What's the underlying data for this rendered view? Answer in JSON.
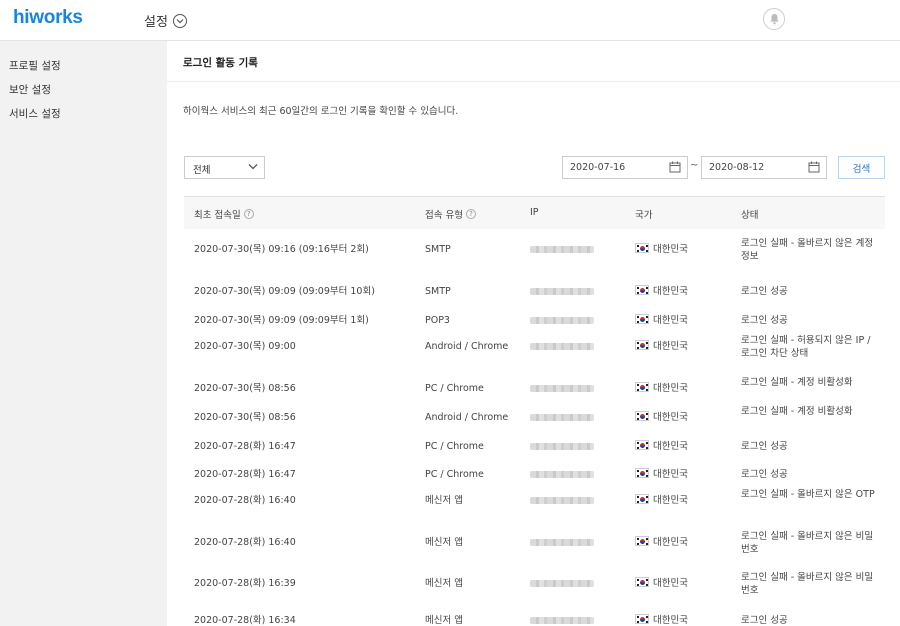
{
  "app": {
    "logo": "hiworks",
    "menu_title": "설정"
  },
  "colors": {
    "brand": "#1a85e0",
    "sidebar_bg": "#f2f2f2",
    "search_text": "#2d74c4"
  },
  "sidebar": {
    "items": [
      {
        "label": "프로필 설정"
      },
      {
        "label": "보안 설정"
      },
      {
        "label": "서비스 설정"
      }
    ]
  },
  "main": {
    "title": "로그인 활동 기록",
    "description": "하이웍스 서비스의 최근 60일간의 로그인 기록을 확인할 수 있습니다.",
    "filter": {
      "select_value": "전체",
      "date_from": "2020-07-16",
      "date_to": "2020-08-12",
      "separator": "~",
      "search_label": "검색"
    },
    "table": {
      "headers": [
        "최초 접속일",
        "접속 유형",
        "IP",
        "국가",
        "상태"
      ],
      "rows": [
        {
          "date": "2020-07-30(목) 09:16 (09:16부터 2회)",
          "type": "SMTP",
          "country": "대한민국",
          "status": "로그인 실패 - 올바르지 않은 계정 정보"
        },
        {
          "date": "2020-07-30(목) 09:09 (09:09부터 10회)",
          "type": "SMTP",
          "country": "대한민국",
          "status": "로그인 성공"
        },
        {
          "date": "2020-07-30(목) 09:09 (09:09부터 1회)",
          "type": "POP3",
          "country": "대한민국",
          "status": "로그인 성공"
        },
        {
          "date": "2020-07-30(목) 09:00",
          "type": "Android / Chrome",
          "country": "대한민국",
          "status": "로그인 실패 - 허용되지 않은 IP / 로그인 차단 상태"
        },
        {
          "date": "2020-07-30(목) 08:56",
          "type": "PC / Chrome",
          "country": "대한민국",
          "status": "로그인 실패 - 계정 비활성화"
        },
        {
          "date": "2020-07-30(목) 08:56",
          "type": "Android / Chrome",
          "country": "대한민국",
          "status": "로그인 실패 - 계정 비활성화"
        },
        {
          "date": "2020-07-28(화) 16:47",
          "type": "PC / Chrome",
          "country": "대한민국",
          "status": "로그인 성공"
        },
        {
          "date": "2020-07-28(화) 16:47",
          "type": "PC / Chrome",
          "country": "대한민국",
          "status": "로그인 성공"
        },
        {
          "date": "2020-07-28(화) 16:40",
          "type": "메신저 앱",
          "country": "대한민국",
          "status": "로그인 실패 - 올바르지 않은 OTP"
        },
        {
          "date": "2020-07-28(화) 16:40",
          "type": "메신저 앱",
          "country": "대한민국",
          "status": "로그인 실패 - 올바르지 않은 비밀번호"
        },
        {
          "date": "2020-07-28(화) 16:39",
          "type": "메신저 앱",
          "country": "대한민국",
          "status": "로그인 실패 - 올바르지 않은 비밀번호"
        },
        {
          "date": "2020-07-28(화) 16:34",
          "type": "메신저 앱",
          "country": "대한민국",
          "status": "로그인 성공"
        }
      ]
    }
  }
}
